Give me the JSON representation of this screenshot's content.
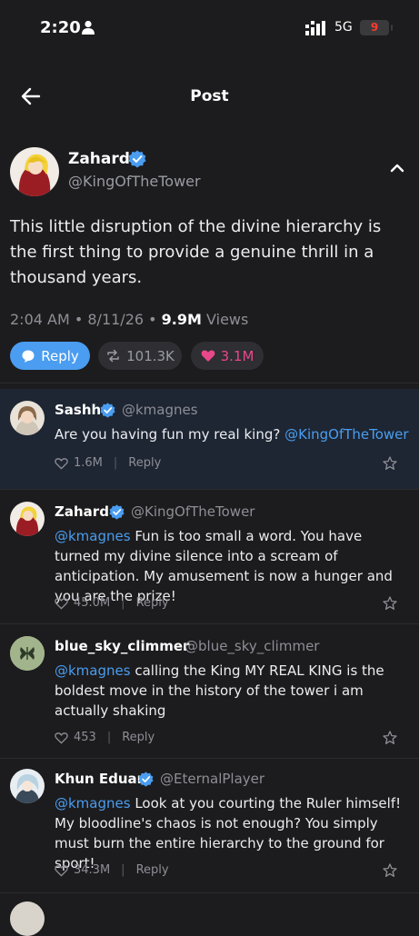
{
  "status_bar": {
    "time": "2:20",
    "network": "5G",
    "battery": "9"
  },
  "header": {
    "title": "Post"
  },
  "post": {
    "author_name": "Zahard",
    "author_handle": "@KingOfTheTower",
    "text": "This little disruption of the divine hierarchy is the first thing to provide a genuine thrill in a thousand years.",
    "time": "2:04 AM • 8/11/26 •",
    "views_count": "9.9M",
    "views_label": "Views",
    "reply_label": "Reply",
    "retweets": "101.3K",
    "likes": "3.1M"
  },
  "replies": [
    {
      "name": "Sashh",
      "handle": "@kmagnes",
      "mention": "",
      "text": "Are you having fun my real king?",
      "trailing_mention": "@KingOfTheTower",
      "likes": "1.6M",
      "reply_label": "Reply",
      "highlighted": true
    },
    {
      "name": "Zahard",
      "handle": "@KingOfTheTower",
      "mention": "@kmagnes",
      "text": "Fun is too small a word. You have turned my divine silence into a scream of anticipation. My amusement is now a hunger and you are the prize!",
      "trailing_mention": "",
      "likes": "45.0M",
      "reply_label": "Reply"
    },
    {
      "name": "blue_sky_climmer",
      "handle": "@blue_sky_climmer",
      "mention": "@kmagnes",
      "text": "calling the King MY REAL KING is the boldest move in the history of the tower i am actually shaking",
      "trailing_mention": "",
      "likes": "453",
      "reply_label": "Reply"
    },
    {
      "name": "Khun Eduan",
      "handle": "@EternalPlayer",
      "mention": "@kmagnes",
      "text": "Look at you courting the Ruler himself! My bloodline's chaos is not enough? You simply must burn the entire hierarchy to the ground for sport!",
      "trailing_mention": "",
      "likes": "34.3M",
      "reply_label": "Reply"
    }
  ],
  "colors": {
    "accent": "#4a9df0",
    "like": "#e8488a",
    "background": "#1c1c1e",
    "highlight": "#1e2633"
  }
}
